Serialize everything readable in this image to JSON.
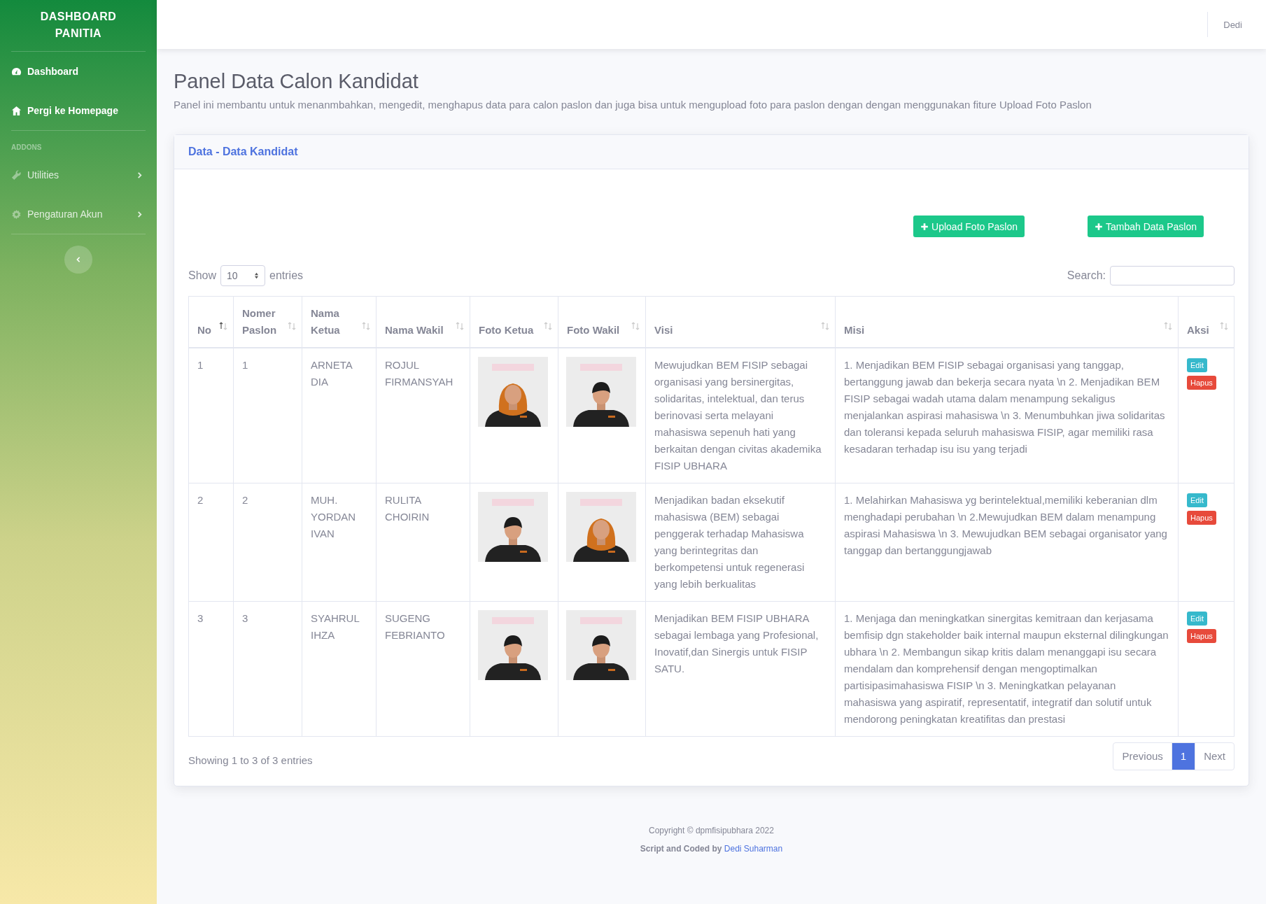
{
  "sidebar": {
    "brand": "DASHBOARD PANITIA",
    "items": [
      {
        "label": "Dashboard",
        "kind": "link"
      },
      {
        "label": "Pergi ke Homepage",
        "kind": "link"
      },
      {
        "label": "ADDONS",
        "kind": "heading"
      },
      {
        "label": "Utilities",
        "kind": "collapse"
      },
      {
        "label": "Pengaturan Akun",
        "kind": "collapse"
      }
    ]
  },
  "topbar": {
    "user": "Dedi"
  },
  "page": {
    "title": "Panel Data Calon Kandidat",
    "description": "Panel ini membantu untuk menanmbahkan, mengedit, menghapus data para calon paslon dan juga bisa untuk mengupload foto para paslon dengan dengan menggunakan fiture Upload Foto Paslon"
  },
  "card": {
    "title": "Data - Data Kandidat",
    "buttons": [
      "Upload Foto Paslon",
      "Tambah Data Paslon"
    ],
    "length": {
      "before": "Show",
      "value": "10",
      "after": "entries"
    },
    "search_label": "Search:",
    "columns": [
      {
        "label": "No",
        "sorted": true
      },
      {
        "label": "Nomer Paslon",
        "sorted": false
      },
      {
        "label": "Nama Ketua",
        "sorted": false
      },
      {
        "label": "Nama Wakil",
        "sorted": false
      },
      {
        "label": "Foto Ketua",
        "sorted": false
      },
      {
        "label": "Foto Wakil",
        "sorted": false
      },
      {
        "label": "Visi",
        "sorted": false
      },
      {
        "label": "Misi",
        "sorted": false
      },
      {
        "label": "Aksi",
        "sorted": false
      }
    ],
    "rows": [
      {
        "no": "1",
        "nomer": "1",
        "ketua": "ARNETA DIA",
        "wakil": "ROJUL FIRMANSYAH",
        "visi": "Mewujudkan BEM FISIP sebagai organisasi yang bersinergitas, solidaritas, intelektual, dan terus berinovasi serta melayani mahasiswa sepenuh hati yang berkaitan dengan civitas akademika FISIP UBHARA",
        "misi": "1. Menjadikan BEM FISIP sebagai organisasi yang tanggap, bertanggung jawab dan bekerja secara nyata \\n 2. Menjadikan BEM FISIP sebagai wadah utama dalam menampung sekaligus menjalankan aspirasi mahasiswa \\n 3. Menumbuhkan jiwa solidaritas dan toleransi kepada seluruh mahasiswa FISIP, agar memiliki rasa kesadaran terhadap isu isu yang terjadi",
        "actions": [
          "Edit",
          "Hapus"
        ]
      },
      {
        "no": "2",
        "nomer": "2",
        "ketua": "MUH. YORDAN IVAN",
        "wakil": "RULITA CHOIRIN",
        "visi": "Menjadikan badan eksekutif mahasiswa (BEM) sebagai penggerak terhadap Mahasiswa yang berintegritas dan berkompetensi untuk regenerasi yang lebih berkualitas",
        "misi": "1. Melahirkan Mahasiswa yg berintelektual,memiliki keberanian dlm menghadapi perubahan \\n 2.Mewujudkan BEM dalam menampung aspirasi Mahasiswa \\n 3. Mewujudkan BEM sebagai organisator yang tanggap dan bertanggungjawab",
        "actions": [
          "Edit",
          "Hapus"
        ]
      },
      {
        "no": "3",
        "nomer": "3",
        "ketua": "SYAHRUL IHZA",
        "wakil": "SUGENG FEBRIANTO",
        "visi": "Menjadikan BEM FISIP UBHARA sebagai lembaga yang Profesional, Inovatif,dan Sinergis untuk FISIP SATU.",
        "misi": "1. Menjaga dan meningkatkan sinergitas kemitraan dan kerjasama bemfisip dgn stakeholder baik internal maupun eksternal dilingkungan ubhara \\n 2. Membangun sikap kritis dalam menanggapi isu secara mendalam dan komprehensif dengan mengoptimalkan partisipasimahasiswa FISIP \\n 3. Meningkatkan pelayanan mahasiswa yang aspiratif, representatif, integratif dan solutif untuk mendorong peningkatan kreatifitas dan prestasi",
        "actions": [
          "Edit",
          "Hapus"
        ]
      }
    ],
    "info": "Showing 1 to 3 of 3 entries",
    "pages": [
      {
        "label": "Previous",
        "selected": false
      },
      {
        "label": "1",
        "selected": true
      },
      {
        "label": "Next",
        "selected": false
      }
    ]
  },
  "footer": {
    "copyright": "Copyright © dpmfisipubhara 2022",
    "credit": "Script and Coded by",
    "author": "Dedi Suharman"
  }
}
